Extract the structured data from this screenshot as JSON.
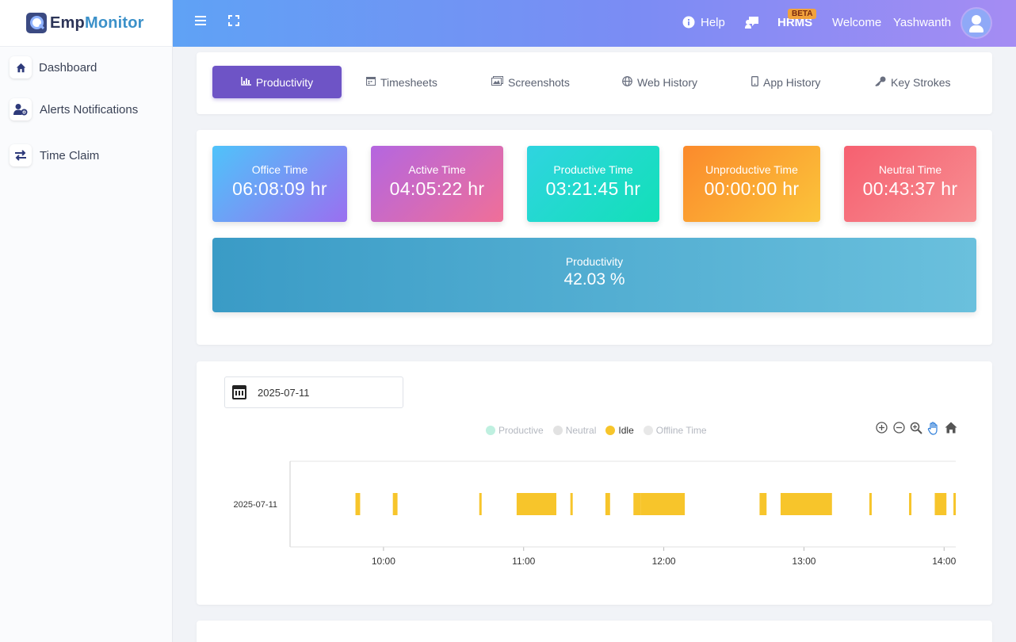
{
  "brand": {
    "part1": "Emp",
    "part2": "Monitor"
  },
  "sidebar": {
    "items": [
      {
        "label": "Dashboard",
        "icon": "home-icon"
      },
      {
        "label": "Alerts Notifications",
        "icon": "user-gear-icon"
      },
      {
        "label": "Time Claim",
        "icon": "swap-arrows-icon"
      }
    ]
  },
  "topbar": {
    "help": "Help",
    "hrms": "HRMS",
    "beta": "BETA",
    "welcome": "Welcome",
    "username": "Yashwanth"
  },
  "tabs": [
    {
      "label": "Productivity",
      "icon": "bar-chart-icon",
      "active": true
    },
    {
      "label": "Timesheets",
      "icon": "calendar-icon",
      "active": false
    },
    {
      "label": "Screenshots",
      "icon": "images-icon",
      "active": false
    },
    {
      "label": "Web History",
      "icon": "globe-icon",
      "active": false
    },
    {
      "label": "App History",
      "icon": "mobile-icon",
      "active": false
    },
    {
      "label": "Key Strokes",
      "icon": "key-icon",
      "active": false
    }
  ],
  "stats": [
    {
      "label": "Office Time",
      "value": "06:08:09 hr"
    },
    {
      "label": "Active Time",
      "value": "04:05:22 hr"
    },
    {
      "label": "Productive Time",
      "value": "03:21:45 hr"
    },
    {
      "label": "Unproductive Time",
      "value": "00:00:00 hr"
    },
    {
      "label": "Neutral Time",
      "value": "00:43:37 hr"
    }
  ],
  "productivity": {
    "label": "Productivity",
    "value": "42.03 %"
  },
  "timeline": {
    "date": "2025-07-11",
    "legend": [
      {
        "label": "Productive",
        "color": "#bff0e0",
        "active": false
      },
      {
        "label": "Neutral",
        "color": "#e2e2e2",
        "active": false
      },
      {
        "label": "Idle",
        "color": "#f7c52b",
        "active": true
      },
      {
        "label": "Offline Time",
        "color": "#e8e8e8",
        "active": false
      }
    ]
  },
  "chart_data": {
    "type": "timeline",
    "row_labels": [
      "2025-07-11"
    ],
    "x_ticks": [
      "10:00",
      "11:00",
      "12:00",
      "13:00",
      "14:00"
    ],
    "xlim": [
      "09:20",
      "14:05"
    ],
    "series": [
      {
        "name": "Idle",
        "color": "#f7c52b",
        "intervals": [
          [
            "09:48",
            "09:50"
          ],
          [
            "10:04",
            "10:06"
          ],
          [
            "10:41",
            "10:42"
          ],
          [
            "10:57",
            "11:14"
          ],
          [
            "11:20",
            "11:21"
          ],
          [
            "11:35",
            "11:37"
          ],
          [
            "11:47",
            "11:50"
          ],
          [
            "11:50",
            "12:09"
          ],
          [
            "12:41",
            "12:44"
          ],
          [
            "12:50",
            "13:12"
          ],
          [
            "13:28",
            "13:29"
          ],
          [
            "13:45",
            "13:46"
          ],
          [
            "13:56",
            "14:01"
          ],
          [
            "14:04",
            "14:05"
          ]
        ]
      }
    ]
  }
}
